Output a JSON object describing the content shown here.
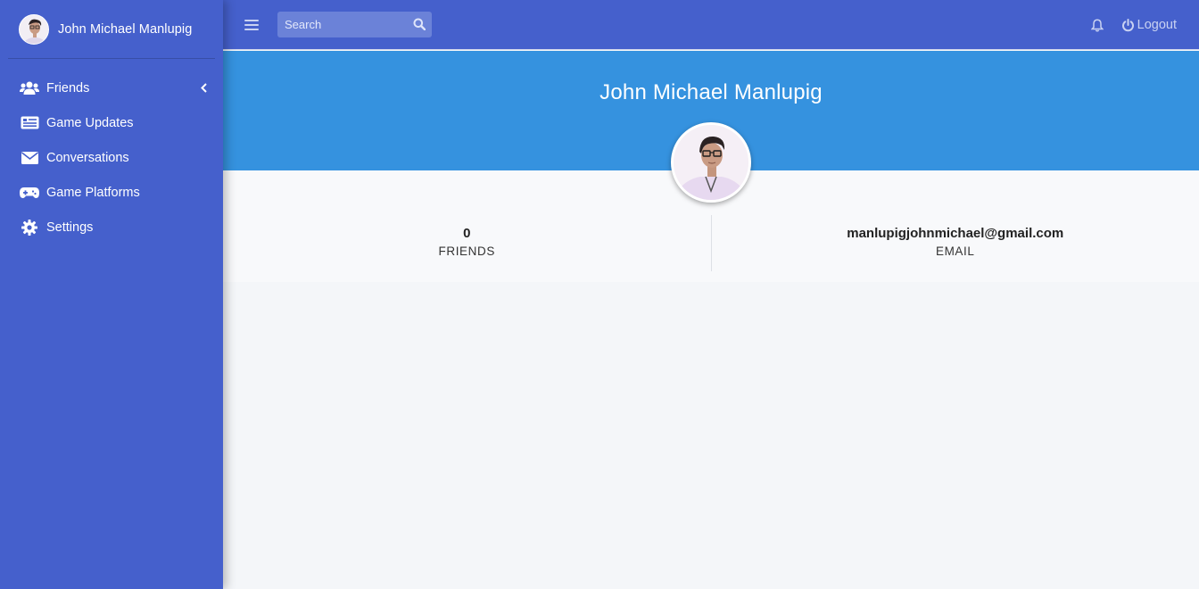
{
  "sidebar": {
    "user_name": "John Michael Manlupig",
    "items": [
      {
        "label": "Friends",
        "icon": "users-icon",
        "has_caret": true
      },
      {
        "label": "Game Updates",
        "icon": "newspaper-icon"
      },
      {
        "label": "Conversations",
        "icon": "envelope-icon"
      },
      {
        "label": "Game Platforms",
        "icon": "gamepad-icon"
      },
      {
        "label": "Settings",
        "icon": "gear-icon"
      }
    ]
  },
  "topbar": {
    "search_placeholder": "Search",
    "logout_label": "Logout"
  },
  "profile": {
    "name": "John Michael Manlupig",
    "stats": [
      {
        "value": "0",
        "label": "FRIENDS"
      },
      {
        "value": "manlupigjohnmichael@gmail.com",
        "label": "EMAIL"
      }
    ]
  },
  "colors": {
    "sidebar_bg": "#4560cc",
    "banner_bg": "#3592df",
    "content_bg": "#f4f6f9"
  }
}
